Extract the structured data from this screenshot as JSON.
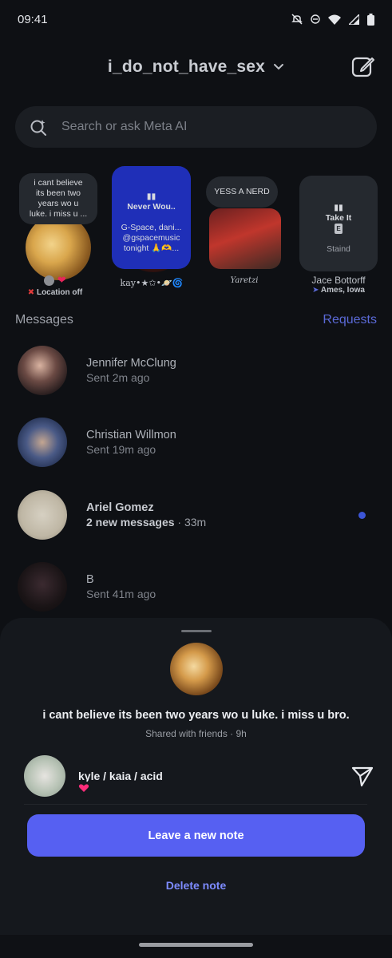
{
  "status_bar": {
    "time": "09:41",
    "icons": [
      "notifications-muted-icon",
      "do-not-disturb-icon",
      "wifi-icon",
      "signal-icon",
      "battery-icon"
    ]
  },
  "header": {
    "account_name": "i_do_not_have_sex",
    "icons": [
      "chevron-down-icon",
      "compose-icon"
    ]
  },
  "search": {
    "placeholder": "Search or ask Meta AI"
  },
  "notes": [
    {
      "bubble": "i cant believe\nits been two\nyears wo u\nluke. i miss u ...",
      "name": "",
      "sub": "Location off"
    },
    {
      "bubble_music_line": "Never Wou..",
      "bubble": "G-Space, dani...\n@gspacemusic\ntonight 🙏🫶...",
      "name": "kay•★✩•🪐🌀"
    },
    {
      "bubble": "YESS A NERD",
      "name": "Yaretzi"
    },
    {
      "bubble_music_line": "Take It",
      "bubble": "Staind",
      "explicit_badge": "E",
      "name": "Jace Bottorff",
      "sub": "Ames, Iowa"
    }
  ],
  "messages": {
    "title": "Messages",
    "requests_label": "Requests",
    "threads": [
      {
        "name": "Jennifer McClung",
        "meta": "Sent 2m ago"
      },
      {
        "name": "Christian Willmon",
        "meta": "Sent 19m ago"
      },
      {
        "name": "Ariel Gomez",
        "meta": "2 new messages",
        "time": "· 33m",
        "unread": true
      },
      {
        "name": "B",
        "meta": "Sent 41m ago"
      }
    ]
  },
  "sheet": {
    "note_text": "i cant believe its been two years wo u luke. i miss u bro.",
    "shared_info": "Shared with friends · 9h",
    "reply_name": "kyle / kaia / acid",
    "primary_button": "Leave a new note",
    "delete_label": "Delete note"
  },
  "colors": {
    "background": "#0e1014",
    "accent": "#5660f2",
    "link": "#5b6ad8",
    "unread_dot": "#3c55d6"
  }
}
